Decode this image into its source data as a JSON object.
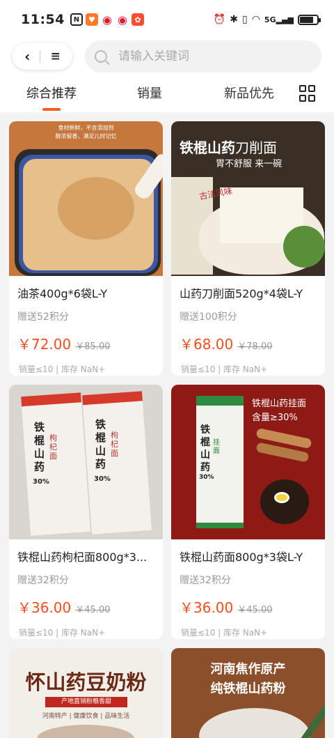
{
  "status_bar": {
    "time": "11:54",
    "network": "5G"
  },
  "search": {
    "placeholder": "请输入关键词"
  },
  "tabs": [
    {
      "label": "综合推荐",
      "active": true
    },
    {
      "label": "销量",
      "active": false
    },
    {
      "label": "新品优先",
      "active": false
    }
  ],
  "colors": {
    "accent": "#ff5b1c",
    "price": "#ff4b1d"
  },
  "products": [
    {
      "name": "油茶400g*6袋L-Y",
      "points": "赠送52积分",
      "price": "￥72.00",
      "old_price": "￥85.00",
      "sales": "销量≤10 | 库存 NaN+",
      "image_text": {
        "line1": "食材新鲜，不含添加剂",
        "line2": "醇浓留香，满足儿时记忆"
      }
    },
    {
      "name": "山药刀削面520g*4袋L-Y",
      "points": "赠送100积分",
      "price": "￥68.00",
      "old_price": "￥78.00",
      "sales": "销量≤10 | 库存 NaN+",
      "image_text": {
        "title_a": "铁棍山药",
        "title_b": "刀削面",
        "sub": "胃不舒服 来一碗",
        "seal": "古法风味"
      }
    },
    {
      "name": "铁棍山药枸杞面800g*3...",
      "points": "赠送32积分",
      "price": "￥36.00",
      "old_price": "￥45.00",
      "sales": "销量≤10 | 库存 NaN+",
      "image_text": {
        "pack": "铁棍山药",
        "flavor": "枸杞面",
        "pct": "30%"
      }
    },
    {
      "name": "铁棍山药面800g*3袋L-Y",
      "points": "赠送32积分",
      "price": "￥36.00",
      "old_price": "￥45.00",
      "sales": "销量≤10 | 库存 NaN+",
      "image_text": {
        "line1": "铁棍山药挂面",
        "line2": "含量≥30%",
        "pack": "铁棍山药",
        "flavor": "挂面",
        "pct": "30%"
      }
    },
    {
      "image_text": {
        "title": "怀山药豆奶粉",
        "band": "产地直销粉粮香甜",
        "sub": "河南特产 | 健康饮食 | 品味生活"
      }
    },
    {
      "image_text": {
        "line1": "河南焦作原产",
        "line2": "纯铁棍山药粉"
      }
    }
  ]
}
